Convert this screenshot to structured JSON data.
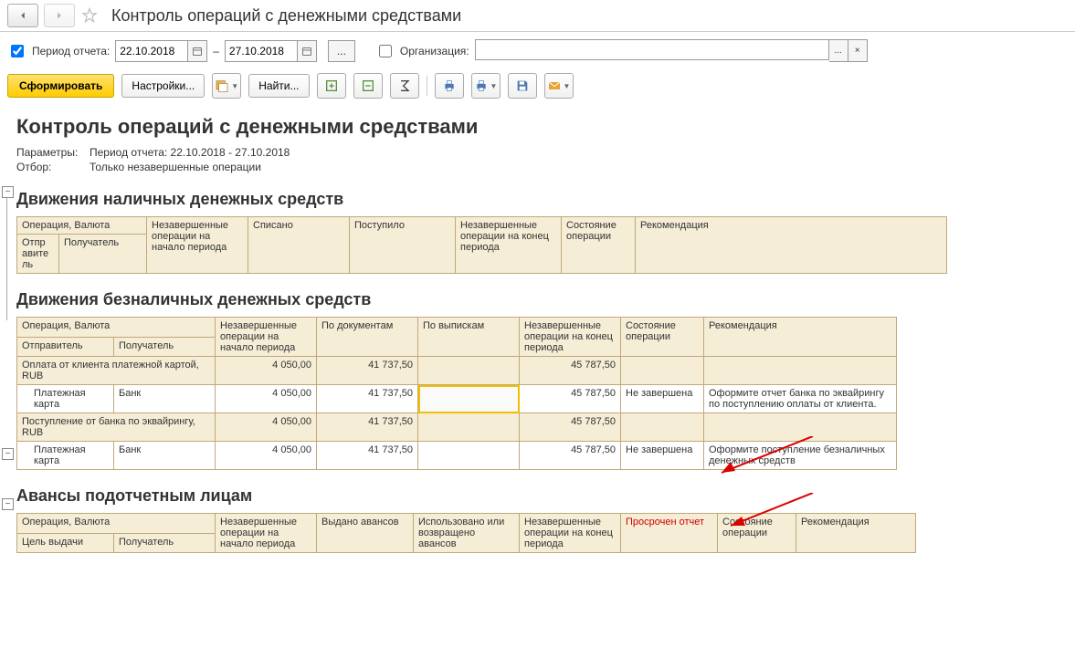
{
  "header": {
    "title": "Контроль операций с денежными средствами"
  },
  "params": {
    "period_label": "Период отчета:",
    "date_from": "22.10.2018",
    "date_to": "27.10.2018",
    "dash": "–",
    "org_label": "Организация:",
    "org_value": ""
  },
  "toolbar": {
    "form": "Сформировать",
    "settings": "Настройки...",
    "find": "Найти..."
  },
  "report": {
    "title": "Контроль операций с денежными средствами",
    "meta_params_label": "Параметры:",
    "meta_params_value": "Период отчета: 22.10.2018 - 27.10.2018",
    "meta_filter_label": "Отбор:",
    "meta_filter_value": "Только незавершенные операции"
  },
  "section1": {
    "title": "Движения наличных денежных средств",
    "h_op": "Операция, Валюта",
    "h_unf_start": "Незавершенные операции на начало периода",
    "h_written": "Списано",
    "h_recv": "Поступило",
    "h_unf_end": "Незавершенные операции на конец периода",
    "h_state": "Состояние операции",
    "h_rec": "Рекомендация",
    "h_sender": "Отпр авите ль",
    "h_receiver": "Получатель"
  },
  "section2": {
    "title": "Движения безналичных денежных средств",
    "h_op": "Операция, Валюта",
    "h_unf_start": "Незавершенные операции на начало периода",
    "h_docs": "По документам",
    "h_stmt": "По выпискам",
    "h_unf_end": "Незавершенные операции на конец периода",
    "h_state": "Состояние операции",
    "h_rec": "Рекомендация",
    "h_sender": "Отправитель",
    "h_receiver": "Получатель",
    "r1_op": "Оплата от клиента платежной картой, RUB",
    "r1_v1": "4 050,00",
    "r1_v2": "41 737,50",
    "r1_v3": "45 787,50",
    "r1a_sender": "Платежная карта",
    "r1a_receiver": "Банк",
    "r1a_v1": "4 050,00",
    "r1a_v2": "41 737,50",
    "r1a_v3": "45 787,50",
    "r1a_state": "Не завершена",
    "r1a_rec": "Оформите отчет банка по эквайрингу по поступлению оплаты от клиента.",
    "r2_op": "Поступление от банка по эквайрингу, RUB",
    "r2_v1": "4 050,00",
    "r2_v2": "41 737,50",
    "r2_v3": "45 787,50",
    "r2a_sender": "Платежная карта",
    "r2a_receiver": "Банк",
    "r2a_v1": "4 050,00",
    "r2a_v2": "41 737,50",
    "r2a_v3": "45 787,50",
    "r2a_state": "Не завершена",
    "r2a_rec": "Оформите поступление безналичных денежных средств"
  },
  "section3": {
    "title": "Авансы подотчетным лицам",
    "h_op": "Операция, Валюта",
    "h_unf_start": "Незавершенные операции на начало периода",
    "h_issued": "Выдано авансов",
    "h_used": "Использовано или возвращено авансов",
    "h_unf_end": "Незавершенные операции на конец периода",
    "h_overdue": "Просрочен отчет",
    "h_state": "Состояние операции",
    "h_rec": "Рекомендация",
    "h_purpose": "Цель выдачи",
    "h_receiver": "Получатель"
  }
}
